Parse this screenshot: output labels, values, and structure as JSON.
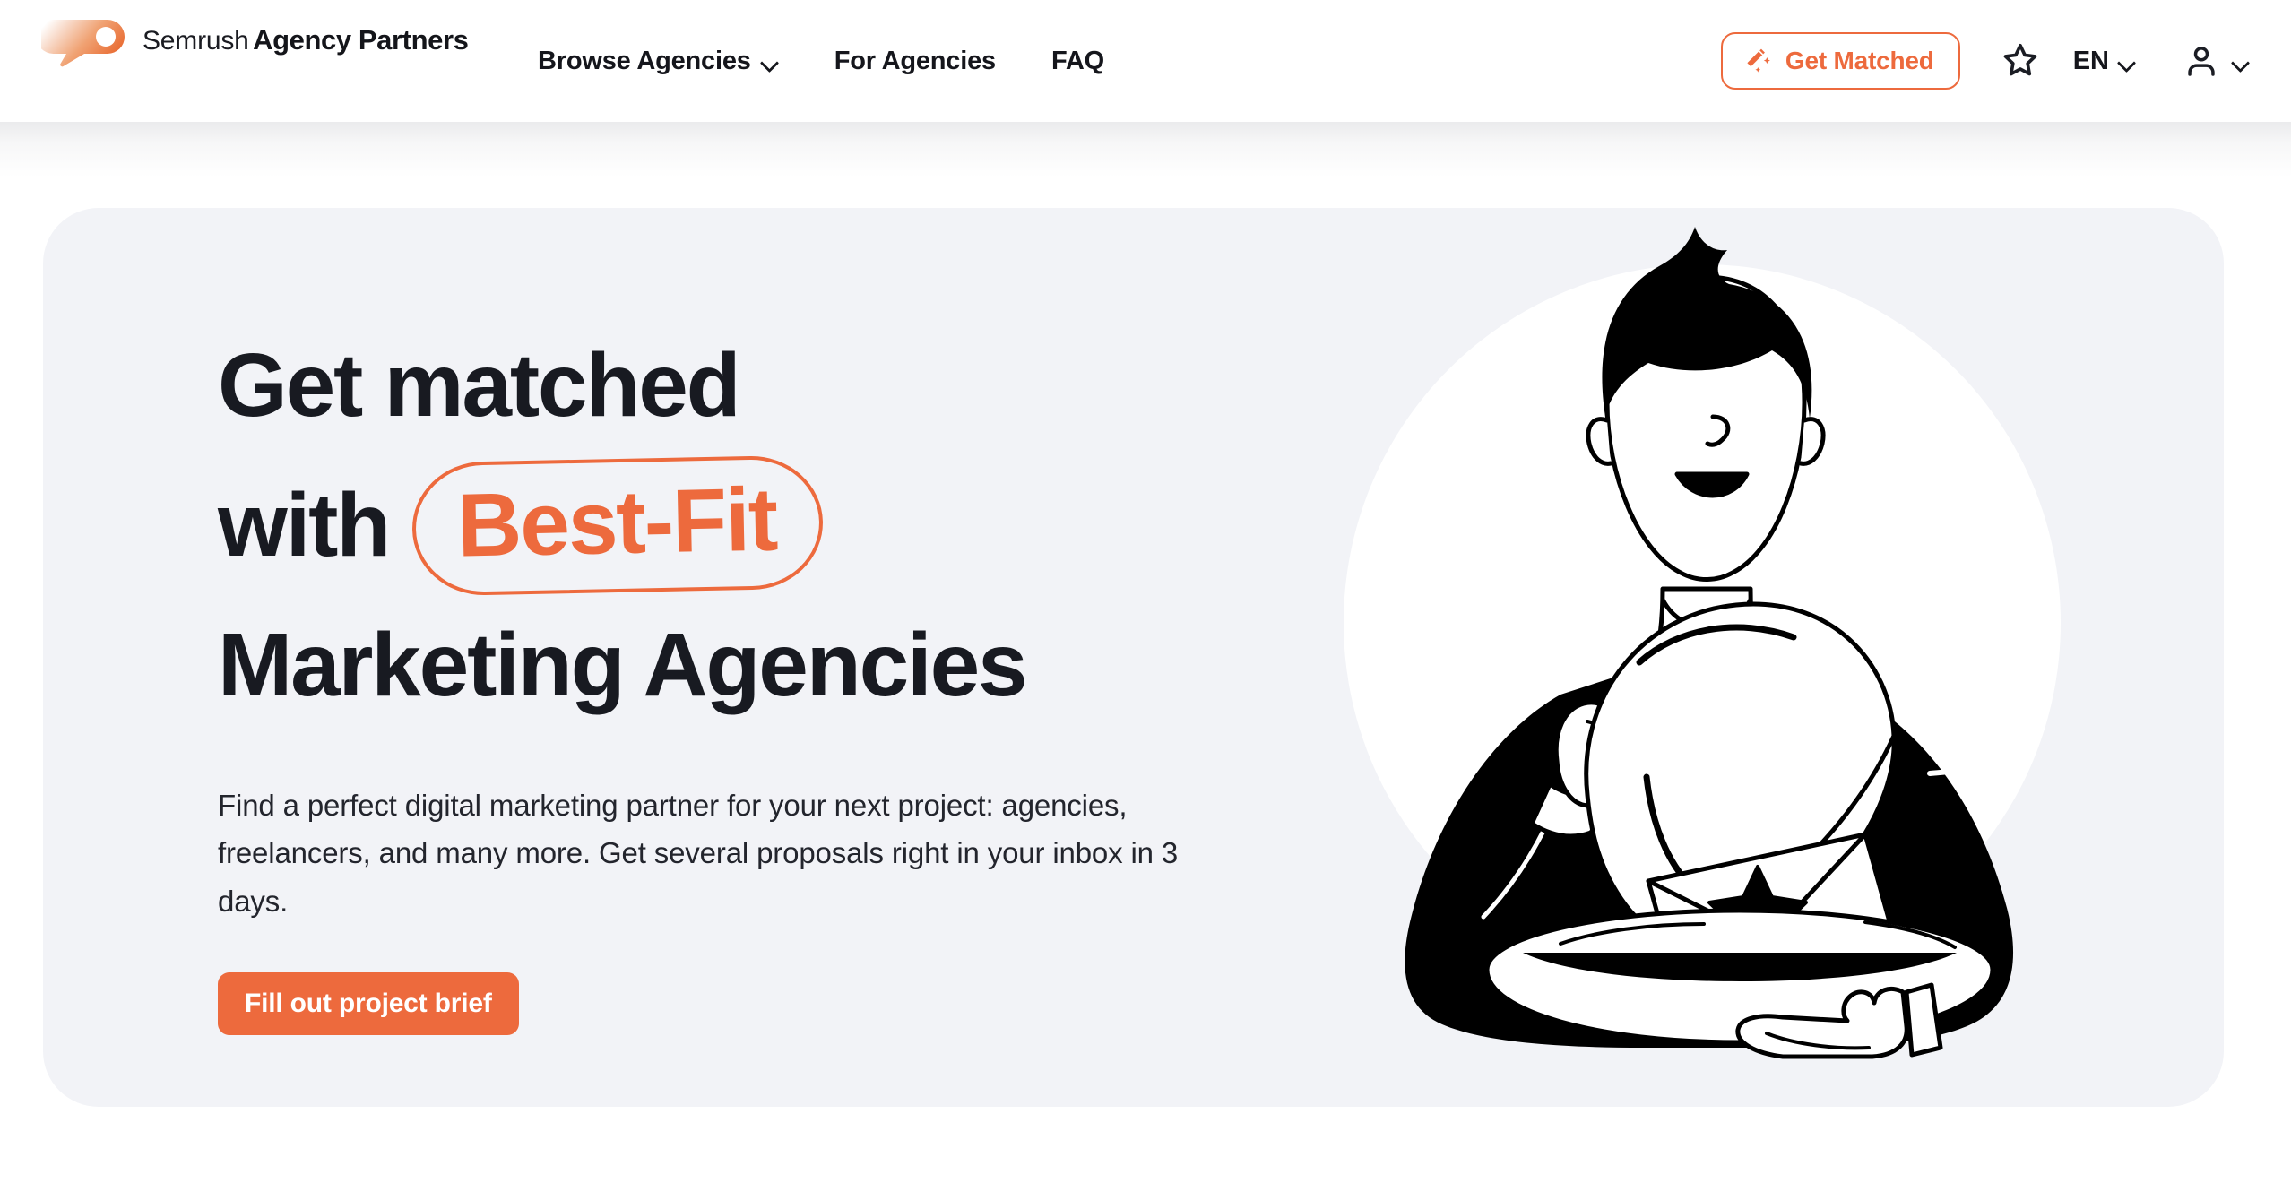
{
  "brand": {
    "name_top": "Semrush",
    "name_bottom": "Agency Partners",
    "accent_color": "#ED6A3D",
    "dark_color": "#181A21",
    "card_bg": "#F2F3F7"
  },
  "header": {
    "nav": [
      {
        "label": "Browse Agencies",
        "has_chevron": true
      },
      {
        "label": "For Agencies",
        "has_chevron": false
      },
      {
        "label": "FAQ",
        "has_chevron": false
      }
    ],
    "get_matched_label": "Get Matched",
    "get_matched_icon": "magic-wand-icon",
    "favorites_icon": "star-icon",
    "language": "EN",
    "language_icon": "chevron-down-icon",
    "account_icon": "person-icon",
    "account_chevron_icon": "chevron-down-icon"
  },
  "hero": {
    "headline_line1": "Get matched",
    "headline_line2_prefix": "with",
    "headline_highlight": "Best-Fit",
    "headline_line3": "Marketing Agencies",
    "subcopy": "Find a perfect digital marketing partner for your next project: agencies, freelancers, and many more. Get several proposals right in your inbox in 3 days.",
    "cta_label": "Fill out project brief",
    "illustration_name": "waiter-serving-envelope-illustration"
  }
}
